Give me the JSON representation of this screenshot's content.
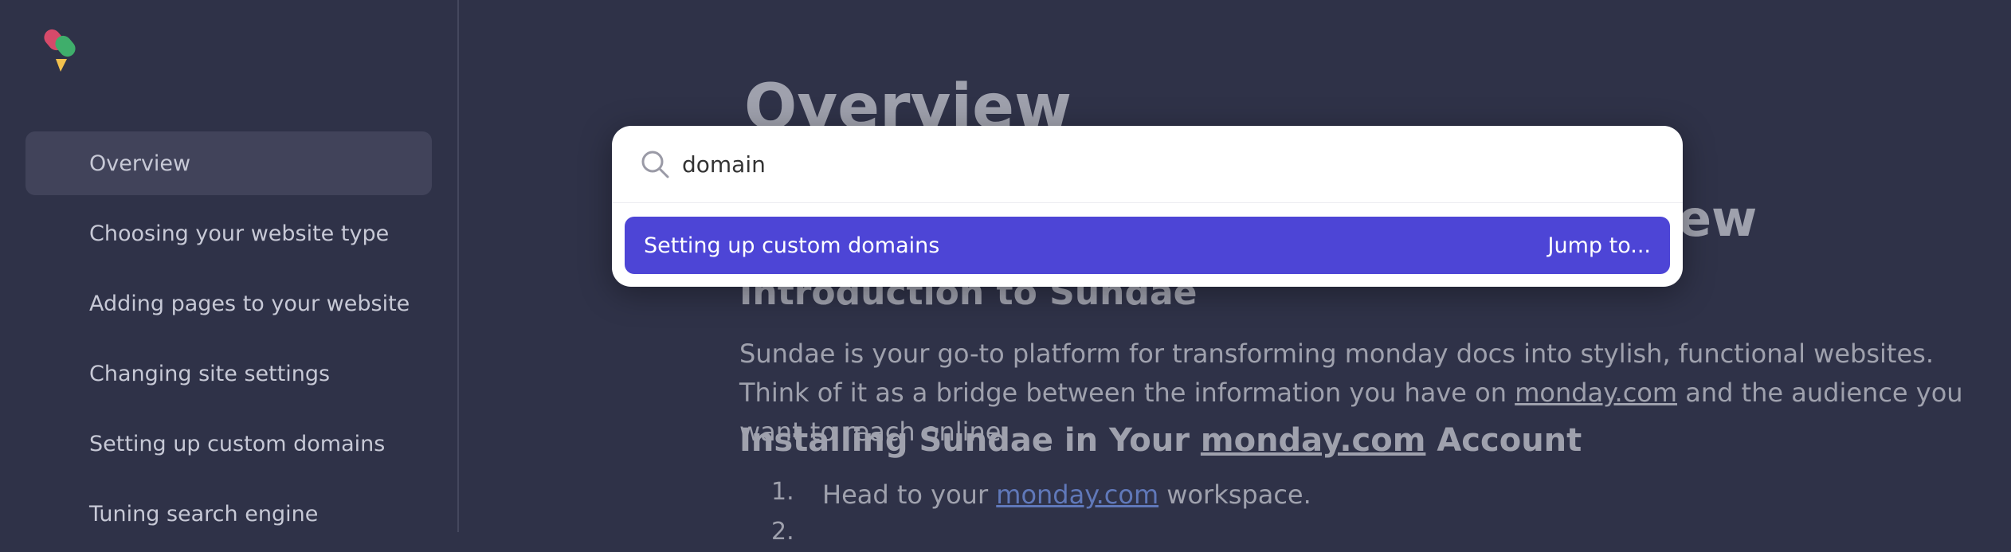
{
  "sidebar": {
    "items": [
      {
        "label": "Overview",
        "active": true
      },
      {
        "label": "Choosing your website type"
      },
      {
        "label": "Adding pages to your website"
      },
      {
        "label": "Changing site settings"
      },
      {
        "label": "Setting up custom domains"
      },
      {
        "label": "Tuning search engine"
      }
    ]
  },
  "main": {
    "title": "Overview",
    "peek_heading": "ew",
    "intro_heading": "Introduction to Sundae",
    "intro_text_1": "Sundae is your go-to platform for transforming monday docs into stylish, functional websites. Think of it as a bridge between the information you have on ",
    "intro_link": "monday.com",
    "intro_text_2": " and the audience you want to reach online.",
    "install_heading_1": "Installing Sundae in Your ",
    "install_heading_link": "monday.com",
    "install_heading_2": " Account",
    "list": {
      "item1_number": "1.",
      "item1_text_1": "Head to your ",
      "item1_link": "monday.com",
      "item1_text_2": " workspace.",
      "item2_number": "2."
    }
  },
  "search": {
    "value": "domain",
    "results": [
      {
        "title": "Setting up custom domains",
        "action": "Jump to..."
      }
    ]
  },
  "colors": {
    "background": "#2f3248",
    "accent": "#4d45d6",
    "link": "#7ea4ff"
  }
}
